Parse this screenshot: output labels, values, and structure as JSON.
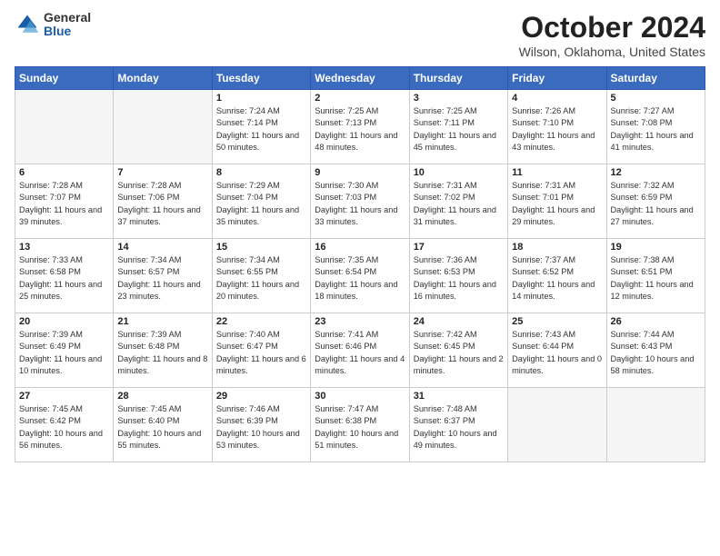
{
  "logo": {
    "general": "General",
    "blue": "Blue"
  },
  "title": "October 2024",
  "location": "Wilson, Oklahoma, United States",
  "days_header": [
    "Sunday",
    "Monday",
    "Tuesday",
    "Wednesday",
    "Thursday",
    "Friday",
    "Saturday"
  ],
  "weeks": [
    [
      {
        "day": "",
        "info": ""
      },
      {
        "day": "",
        "info": ""
      },
      {
        "day": "1",
        "info": "Sunrise: 7:24 AM\nSunset: 7:14 PM\nDaylight: 11 hours and 50 minutes."
      },
      {
        "day": "2",
        "info": "Sunrise: 7:25 AM\nSunset: 7:13 PM\nDaylight: 11 hours and 48 minutes."
      },
      {
        "day": "3",
        "info": "Sunrise: 7:25 AM\nSunset: 7:11 PM\nDaylight: 11 hours and 45 minutes."
      },
      {
        "day": "4",
        "info": "Sunrise: 7:26 AM\nSunset: 7:10 PM\nDaylight: 11 hours and 43 minutes."
      },
      {
        "day": "5",
        "info": "Sunrise: 7:27 AM\nSunset: 7:08 PM\nDaylight: 11 hours and 41 minutes."
      }
    ],
    [
      {
        "day": "6",
        "info": "Sunrise: 7:28 AM\nSunset: 7:07 PM\nDaylight: 11 hours and 39 minutes."
      },
      {
        "day": "7",
        "info": "Sunrise: 7:28 AM\nSunset: 7:06 PM\nDaylight: 11 hours and 37 minutes."
      },
      {
        "day": "8",
        "info": "Sunrise: 7:29 AM\nSunset: 7:04 PM\nDaylight: 11 hours and 35 minutes."
      },
      {
        "day": "9",
        "info": "Sunrise: 7:30 AM\nSunset: 7:03 PM\nDaylight: 11 hours and 33 minutes."
      },
      {
        "day": "10",
        "info": "Sunrise: 7:31 AM\nSunset: 7:02 PM\nDaylight: 11 hours and 31 minutes."
      },
      {
        "day": "11",
        "info": "Sunrise: 7:31 AM\nSunset: 7:01 PM\nDaylight: 11 hours and 29 minutes."
      },
      {
        "day": "12",
        "info": "Sunrise: 7:32 AM\nSunset: 6:59 PM\nDaylight: 11 hours and 27 minutes."
      }
    ],
    [
      {
        "day": "13",
        "info": "Sunrise: 7:33 AM\nSunset: 6:58 PM\nDaylight: 11 hours and 25 minutes."
      },
      {
        "day": "14",
        "info": "Sunrise: 7:34 AM\nSunset: 6:57 PM\nDaylight: 11 hours and 23 minutes."
      },
      {
        "day": "15",
        "info": "Sunrise: 7:34 AM\nSunset: 6:55 PM\nDaylight: 11 hours and 20 minutes."
      },
      {
        "day": "16",
        "info": "Sunrise: 7:35 AM\nSunset: 6:54 PM\nDaylight: 11 hours and 18 minutes."
      },
      {
        "day": "17",
        "info": "Sunrise: 7:36 AM\nSunset: 6:53 PM\nDaylight: 11 hours and 16 minutes."
      },
      {
        "day": "18",
        "info": "Sunrise: 7:37 AM\nSunset: 6:52 PM\nDaylight: 11 hours and 14 minutes."
      },
      {
        "day": "19",
        "info": "Sunrise: 7:38 AM\nSunset: 6:51 PM\nDaylight: 11 hours and 12 minutes."
      }
    ],
    [
      {
        "day": "20",
        "info": "Sunrise: 7:39 AM\nSunset: 6:49 PM\nDaylight: 11 hours and 10 minutes."
      },
      {
        "day": "21",
        "info": "Sunrise: 7:39 AM\nSunset: 6:48 PM\nDaylight: 11 hours and 8 minutes."
      },
      {
        "day": "22",
        "info": "Sunrise: 7:40 AM\nSunset: 6:47 PM\nDaylight: 11 hours and 6 minutes."
      },
      {
        "day": "23",
        "info": "Sunrise: 7:41 AM\nSunset: 6:46 PM\nDaylight: 11 hours and 4 minutes."
      },
      {
        "day": "24",
        "info": "Sunrise: 7:42 AM\nSunset: 6:45 PM\nDaylight: 11 hours and 2 minutes."
      },
      {
        "day": "25",
        "info": "Sunrise: 7:43 AM\nSunset: 6:44 PM\nDaylight: 11 hours and 0 minutes."
      },
      {
        "day": "26",
        "info": "Sunrise: 7:44 AM\nSunset: 6:43 PM\nDaylight: 10 hours and 58 minutes."
      }
    ],
    [
      {
        "day": "27",
        "info": "Sunrise: 7:45 AM\nSunset: 6:42 PM\nDaylight: 10 hours and 56 minutes."
      },
      {
        "day": "28",
        "info": "Sunrise: 7:45 AM\nSunset: 6:40 PM\nDaylight: 10 hours and 55 minutes."
      },
      {
        "day": "29",
        "info": "Sunrise: 7:46 AM\nSunset: 6:39 PM\nDaylight: 10 hours and 53 minutes."
      },
      {
        "day": "30",
        "info": "Sunrise: 7:47 AM\nSunset: 6:38 PM\nDaylight: 10 hours and 51 minutes."
      },
      {
        "day": "31",
        "info": "Sunrise: 7:48 AM\nSunset: 6:37 PM\nDaylight: 10 hours and 49 minutes."
      },
      {
        "day": "",
        "info": ""
      },
      {
        "day": "",
        "info": ""
      }
    ]
  ]
}
